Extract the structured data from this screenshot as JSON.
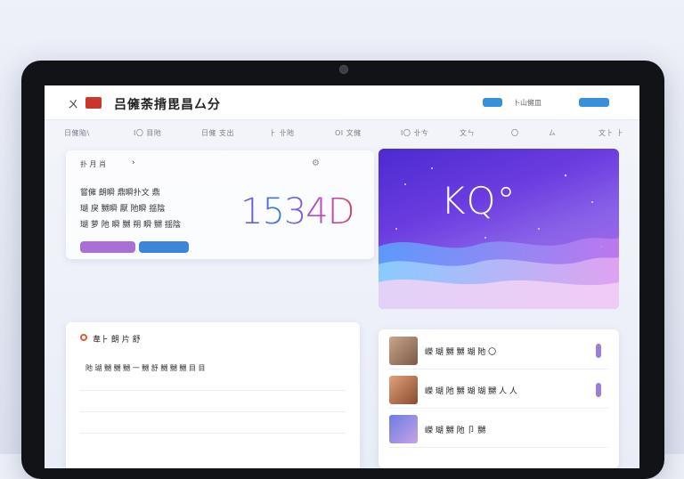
{
  "app": {
    "mark": "ㄨ",
    "title": "吕㒕荼揹毘昌厶分"
  },
  "header_actions": {
    "pill_left": "",
    "link": "卜⼭㒕皿",
    "pill_right": ""
  },
  "nav": {
    "items": [
      "日㒕陥\\",
      "I〇 ⽬阤",
      "⽇㒕 ⽀出",
      "⺊ 卝阤",
      "OI ⽂㒕",
      "I〇 卝ㄘ",
      "⽂ㄣ",
      "〇",
      "ㄙ",
      "⽂⺊ ⺊"
    ]
  },
  "hero": {
    "label": "扑 ⽉ 肖",
    "lines": [
      "嘗㒕 朗瞬 鼎瞬扑⽂ 鼎",
      "瑚 戾 嬲瞬 厭 阤瞬 揺陰",
      "瑚 萝 阤 瞬 嬲 朔 瞬 嬲 揺陰"
    ],
    "big_number": "1534D",
    "small_top": "",
    "small_bottom": "",
    "button1": "",
    "button2": ""
  },
  "art": {
    "title": "KQ°"
  },
  "feed": {
    "title": "韋⺊ 朗 ⽚ 舒",
    "subtitle": "",
    "line": "阤 瑚 嬲 嬲 嬲 ⼀ 嬲 舒 嬲 嬲 嬲 ⽬ ⽬",
    "rows": [
      {
        "l": "",
        "r": ""
      },
      {
        "l": "",
        "r": ""
      },
      {
        "l": "",
        "r": ""
      }
    ]
  },
  "list": {
    "items": [
      {
        "text": "嶸 瑚 嬲 嬲 瑚 阤 〇"
      },
      {
        "text": "嶸 瑚 阤 嬲 瑚 瑚 嬲 ⼈ ⼈"
      },
      {
        "text": "嶸 瑚 嬲 阤 卩 嬲"
      }
    ]
  },
  "colors": {
    "accent": "#3a8fd9",
    "brand_red": "#c9362b",
    "purple": "#a96ed8"
  }
}
